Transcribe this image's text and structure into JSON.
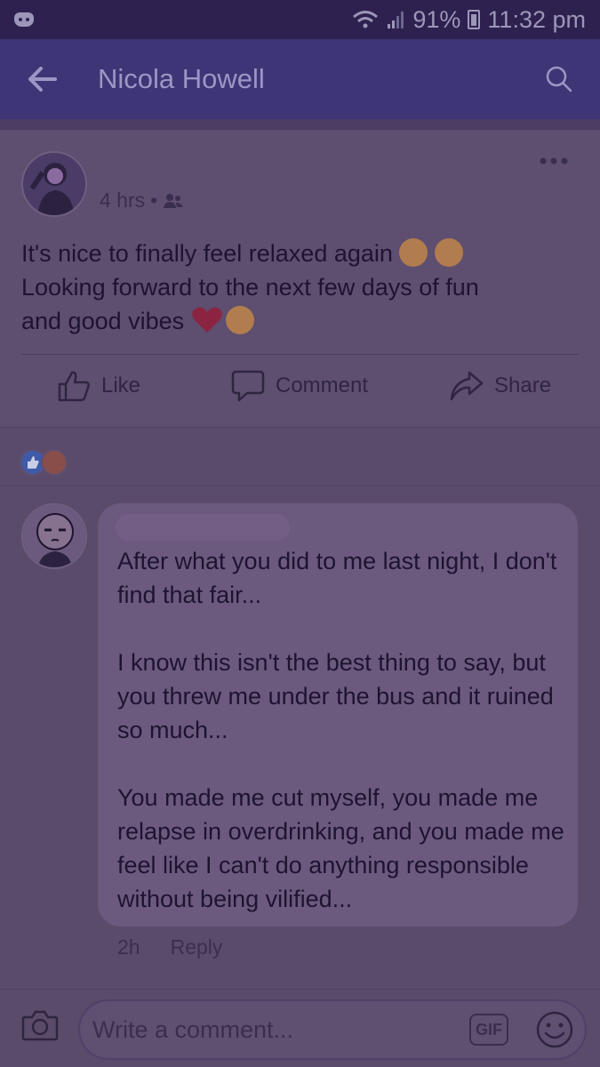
{
  "status_bar": {
    "battery": "91%",
    "time": "11:32 pm"
  },
  "header": {
    "title": "Nicola Howell"
  },
  "post": {
    "time": "4 hrs",
    "text_line1": "It's nice to finally feel relaxed again",
    "text_line2": "Looking forward to the next few days of fun",
    "text_line3": "and good vibes",
    "actions": {
      "like": "Like",
      "comment": "Comment",
      "share": "Share"
    }
  },
  "comment": {
    "paragraph1": "After what you did to me last night, I don't find that fair...",
    "paragraph2": "I know this isn't the best thing to say, but you threw me under the bus and it ruined so much...",
    "paragraph3": "You made me cut myself, you made me relapse in overdrinking, and you made me feel like I can't do anything responsible without being vilified...",
    "time": "2h",
    "reply": "Reply"
  },
  "composer": {
    "placeholder": "Write a comment...",
    "gif_label": "GIF"
  },
  "icons": {
    "back": "arrow-left-icon",
    "search": "search-icon",
    "more": "more-horizontal-icon",
    "friends": "friends-icon",
    "like": "thumbs-up-icon",
    "comment": "speech-bubble-icon",
    "share": "share-arrow-icon",
    "camera": "camera-icon",
    "emoji": "smiley-icon"
  },
  "colors": {
    "app_bar": "#3e3577",
    "status_bar": "#2e2150",
    "background": "#5e4e70",
    "like_reaction": "#3f5aa8"
  }
}
